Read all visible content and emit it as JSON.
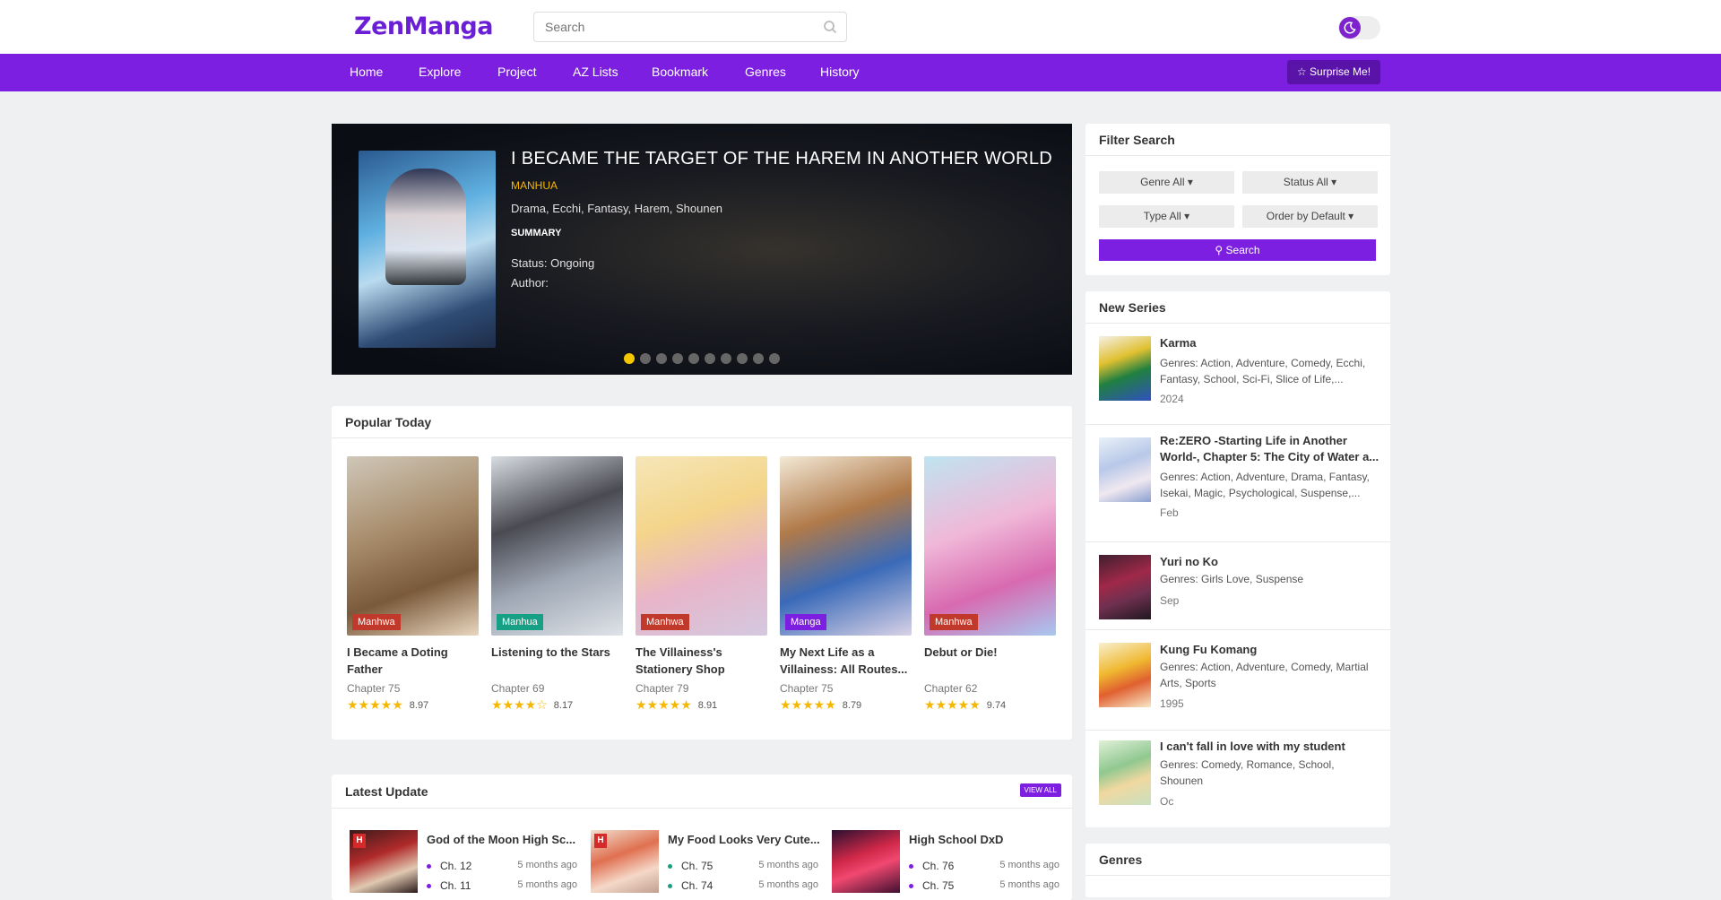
{
  "header": {
    "logo": "ZenManga",
    "search_placeholder": "Search",
    "theme_toggle_icon": "moon-icon"
  },
  "nav": {
    "items": [
      "Home",
      "Explore",
      "Project",
      "AZ Lists",
      "Bookmark",
      "Genres",
      "History"
    ],
    "surprise": "Surprise Me!"
  },
  "slider": {
    "title": "I BECAME THE TARGET OF THE HAREM IN ANOTHER WORLD",
    "type": "MANHUA",
    "genres": "Drama, Ecchi, Fantasy, Harem, Shounen",
    "summary_label": "SUMMARY",
    "status": "Status: Ongoing",
    "author": "Author:",
    "slide_count": 10,
    "active_slide": 1
  },
  "popular": {
    "title": "Popular Today",
    "items": [
      {
        "title": "I Became a Doting Father",
        "tag": "Manhwa",
        "chapter": "Chapter 75",
        "rating": "8.97",
        "stars": "★★★★★"
      },
      {
        "title": "Listening to the Stars",
        "tag": "Manhua",
        "chapter": "Chapter 69",
        "rating": "8.17",
        "stars": "★★★★☆"
      },
      {
        "title": "The Villainess's Stationery Shop",
        "tag": "Manhwa",
        "chapter": "Chapter 79",
        "rating": "8.91",
        "stars": "★★★★★"
      },
      {
        "title": "My Next Life as a Villainess: All Routes...",
        "tag": "Manga",
        "chapter": "Chapter 75",
        "rating": "8.79",
        "stars": "★★★★★"
      },
      {
        "title": "Debut or Die!",
        "tag": "Manhwa",
        "chapter": "Chapter 62",
        "rating": "9.74",
        "stars": "★★★★★"
      }
    ]
  },
  "latest": {
    "title": "Latest Update",
    "view_all": "VIEW ALL",
    "items": [
      {
        "title": "God of the Moon High Sc...",
        "badge": "H",
        "chapters": [
          {
            "ch": "Ch. 12",
            "time": "5 months ago"
          },
          {
            "ch": "Ch. 11",
            "time": "5 months ago"
          }
        ]
      },
      {
        "title": "My Food Looks Very Cute...",
        "badge": "H",
        "chapters": [
          {
            "ch": "Ch. 75",
            "time": "5 months ago"
          },
          {
            "ch": "Ch. 74",
            "time": "5 months ago"
          }
        ]
      },
      {
        "title": "High School DxD",
        "badge": "",
        "chapters": [
          {
            "ch": "Ch. 76",
            "time": "5 months ago"
          },
          {
            "ch": "Ch. 75",
            "time": "5 months ago"
          }
        ]
      }
    ]
  },
  "filter": {
    "title": "Filter Search",
    "genre": "Genre All",
    "status": "Status All",
    "type": "Type All",
    "order": "Order by Default",
    "search": "Search"
  },
  "new_series": {
    "title": "New Series",
    "items": [
      {
        "title": "Karma",
        "genres": "Genres: Action, Adventure, Comedy, Ecchi, Fantasy, School, Sci-Fi, Slice of Life,...",
        "date": "2024"
      },
      {
        "title": "Re:ZERO -Starting Life in Another World-, Chapter 5: The City of Water a...",
        "genres": "Genres: Action, Adventure, Drama, Fantasy, Isekai, Magic, Psychological, Suspense,...",
        "date": "Feb"
      },
      {
        "title": "Yuri no Ko",
        "genres": "Genres: Girls Love, Suspense",
        "date": "Sep"
      },
      {
        "title": "Kung Fu Komang",
        "genres": "Genres: Action, Adventure, Comedy, Martial Arts, Sports",
        "date": "1995"
      },
      {
        "title": "I can't fall in love with my student",
        "genres": "Genres: Comedy, Romance, School, Shounen",
        "date": "Oc"
      }
    ]
  },
  "genres_panel": {
    "title": "Genres"
  }
}
